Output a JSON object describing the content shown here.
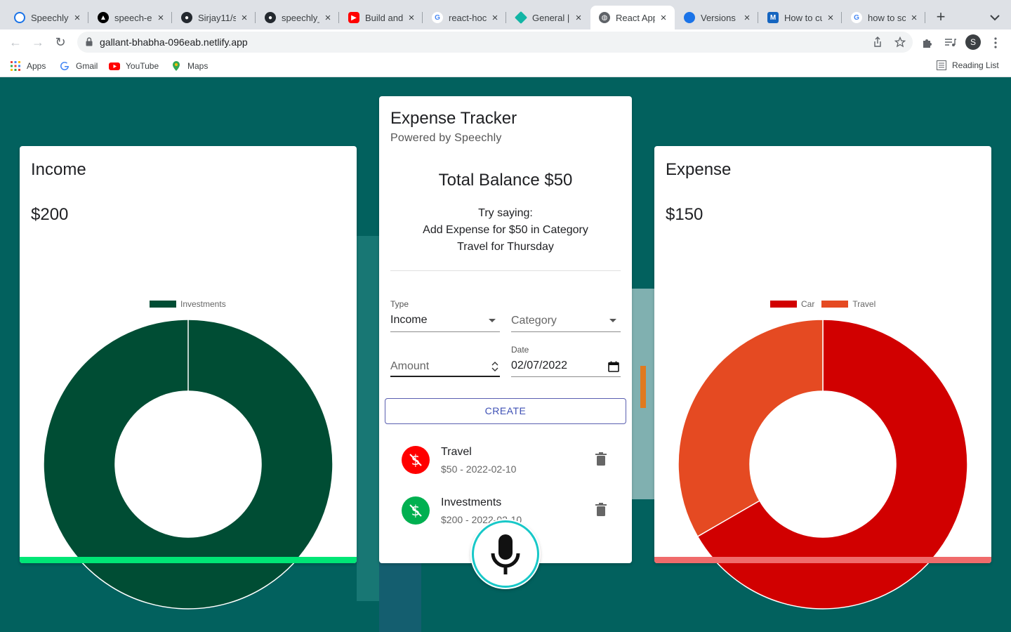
{
  "browser": {
    "tabs": [
      {
        "title": "Speechly",
        "icon_color": "#1a73e8",
        "active": false
      },
      {
        "title": "speech-e",
        "icon_color": "#000000",
        "active": false
      },
      {
        "title": "Sirjay11/s",
        "icon_color": "#24292f",
        "active": false
      },
      {
        "title": "speechly_",
        "icon_color": "#24292f",
        "active": false
      },
      {
        "title": "Build and",
        "icon_color": "#ff0000",
        "active": false
      },
      {
        "title": "react-hoc",
        "icon_color": "#4285f4",
        "active": false
      },
      {
        "title": "General |",
        "icon_color": "#12b5a5",
        "active": false
      },
      {
        "title": "React App",
        "icon_color": "#5f6368",
        "active": true
      },
      {
        "title": "Versions",
        "icon_color": "#1a73e8",
        "active": false
      },
      {
        "title": "How to cu",
        "icon_color": "#1565c0",
        "active": false
      },
      {
        "title": "how to sc",
        "icon_color": "#4285f4",
        "active": false
      }
    ],
    "url": "gallant-bhabha-096eab.netlify.app",
    "profile_initial": "S",
    "bookmarks": [
      "Apps",
      "Gmail",
      "YouTube",
      "Maps"
    ],
    "reading_list": "Reading List"
  },
  "income": {
    "title": "Income",
    "amount": "$200",
    "strip_color": "#00e676",
    "legend": [
      {
        "label": "Investments",
        "color": "#004d34"
      }
    ]
  },
  "expense": {
    "title": "Expense",
    "amount": "$150",
    "strip_color": "#f06b6b",
    "legend": [
      {
        "label": "Car",
        "color": "#d10000"
      },
      {
        "label": "Travel",
        "color": "#e54a22"
      }
    ]
  },
  "tracker": {
    "title": "Expense Tracker",
    "subtitle": "Powered by Speechly",
    "balance": "Total Balance $50",
    "hint_line1": "Try saying:",
    "hint_line2": "Add Expense for $50 in Category",
    "hint_line3": "Travel for Thursday",
    "form": {
      "type_label": "Type",
      "type_value": "Income",
      "category_placeholder": "Category",
      "amount_placeholder": "Amount",
      "date_label": "Date",
      "date_value": "02/07/2022",
      "create_label": "CREATE"
    },
    "transactions": [
      {
        "name": "Travel",
        "detail": "$50 - 2022-02-10",
        "color": "#ff0000"
      },
      {
        "name": "Investments",
        "detail": "$200 - 2022-02-10",
        "color": "#00b050"
      }
    ]
  },
  "chart_data": [
    {
      "type": "pie",
      "title": "",
      "labels": [
        "Investments"
      ],
      "values": [
        200
      ],
      "colors": [
        "#004d34"
      ],
      "legend": "top"
    },
    {
      "type": "pie",
      "title": "",
      "labels": [
        "Car",
        "Travel"
      ],
      "values": [
        100,
        50
      ],
      "colors": [
        "#d10000",
        "#e54a22"
      ],
      "legend": "top"
    }
  ]
}
